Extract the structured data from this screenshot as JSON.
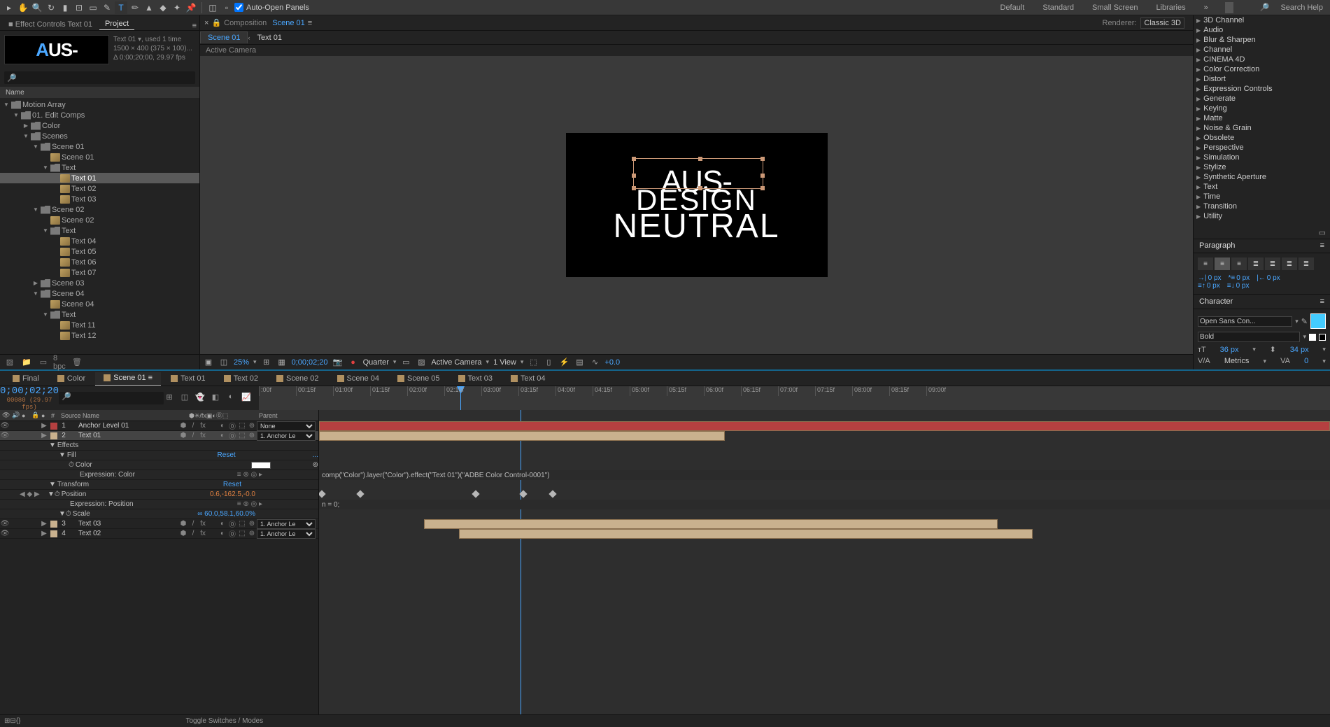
{
  "toolbar": {
    "autoOpen": "Auto-Open Panels",
    "workspaces": [
      "Default",
      "Standard",
      "Small Screen",
      "Libraries"
    ],
    "searchPlaceholder": "Search Help"
  },
  "project": {
    "tabEffect": "Effect Controls Text 01",
    "tabProject": "Project",
    "thumbName": "Text 01 ▾",
    "meta1": ", used 1 time",
    "meta2": "1500 × 400 (375 × 100)...",
    "meta3": "Δ 0;00;20;00, 29.97 fps",
    "headerName": "Name",
    "tree": [
      {
        "d": 0,
        "t": "f",
        "open": true,
        "n": "Motion Array"
      },
      {
        "d": 1,
        "t": "f",
        "open": true,
        "n": "01. Edit Comps"
      },
      {
        "d": 2,
        "t": "f",
        "open": false,
        "n": "Color"
      },
      {
        "d": 2,
        "t": "f",
        "open": true,
        "n": "Scenes"
      },
      {
        "d": 3,
        "t": "f",
        "open": true,
        "n": "Scene 01"
      },
      {
        "d": 4,
        "t": "c",
        "n": "Scene 01"
      },
      {
        "d": 4,
        "t": "f",
        "open": true,
        "n": "Text"
      },
      {
        "d": 5,
        "t": "c",
        "n": "Text 01",
        "sel": true
      },
      {
        "d": 5,
        "t": "c",
        "n": "Text 02"
      },
      {
        "d": 5,
        "t": "c",
        "n": "Text 03"
      },
      {
        "d": 3,
        "t": "f",
        "open": true,
        "n": "Scene 02"
      },
      {
        "d": 4,
        "t": "c",
        "n": "Scene 02"
      },
      {
        "d": 4,
        "t": "f",
        "open": true,
        "n": "Text"
      },
      {
        "d": 5,
        "t": "c",
        "n": "Text 04"
      },
      {
        "d": 5,
        "t": "c",
        "n": "Text 05"
      },
      {
        "d": 5,
        "t": "c",
        "n": "Text 06"
      },
      {
        "d": 5,
        "t": "c",
        "n": "Text 07"
      },
      {
        "d": 3,
        "t": "f",
        "open": false,
        "n": "Scene 03"
      },
      {
        "d": 3,
        "t": "f",
        "open": true,
        "n": "Scene 04"
      },
      {
        "d": 4,
        "t": "c",
        "n": "Scene 04"
      },
      {
        "d": 4,
        "t": "f",
        "open": true,
        "n": "Text"
      },
      {
        "d": 5,
        "t": "c",
        "n": "Text 11"
      },
      {
        "d": 5,
        "t": "c",
        "n": "Text 12"
      }
    ],
    "bpc": "8 bpc"
  },
  "comp": {
    "label": "Composition",
    "name": "Scene 01",
    "subActive": "Scene 01",
    "subOther": "Text 01",
    "rendererLabel": "Renderer:",
    "renderer": "Classic 3D",
    "activeCamera": "Active Camera",
    "line1": "AUS-",
    "line2": "DESIGN",
    "line3": "NEUTRAL",
    "zoom": "25%",
    "timecode": "0;00;02;20",
    "quality": "Quarter",
    "view": "Active Camera",
    "nviews": "1 View",
    "exposure": "+0.0"
  },
  "effects": {
    "cats": [
      "3D Channel",
      "Audio",
      "Blur & Sharpen",
      "Channel",
      "CINEMA 4D",
      "Color Correction",
      "Distort",
      "Expression Controls",
      "Generate",
      "Keying",
      "Matte",
      "Noise & Grain",
      "Obsolete",
      "Perspective",
      "Simulation",
      "Stylize",
      "Synthetic Aperture",
      "Text",
      "Time",
      "Transition",
      "Utility"
    ]
  },
  "paragraph": {
    "title": "Paragraph",
    "px": "0 px"
  },
  "character": {
    "title": "Character",
    "font": "Open Sans Con...",
    "weight": "Bold",
    "size": "36 px",
    "leading": "34 px",
    "kerning": "Metrics",
    "tracking": "0"
  },
  "timeline": {
    "tabs": [
      "Final",
      "Color",
      "Scene 01",
      "Text 01",
      "Text 02",
      "Scene 02",
      "Scene 04",
      "Scene 05",
      "Text 03",
      "Text 04"
    ],
    "activeTab": 2,
    "timecode": "0;00;02;20",
    "frameinfo": "00080 (29.97 fps)",
    "ticks": [
      ":00f",
      "00:15f",
      "01:00f",
      "01:15f",
      "02:00f",
      "02:15f",
      "03:00f",
      "03:15f",
      "04:00f",
      "04:15f",
      "05:00f",
      "05:15f",
      "06:00f",
      "06:15f",
      "07:00f",
      "07:15f",
      "08:00f",
      "08:15f",
      "09:00f"
    ],
    "cols": {
      "source": "Source Name",
      "parent": "Parent"
    },
    "layers": [
      {
        "num": "1",
        "color": "#b54040",
        "name": "Anchor Level 01",
        "parent": "None"
      },
      {
        "num": "2",
        "color": "#c9b18e",
        "name": "Text 01",
        "parent": "1. Anchor Le",
        "sel": true
      },
      {
        "prop": true,
        "d": 1,
        "name": "Effects"
      },
      {
        "prop": true,
        "d": 2,
        "name": "Fill",
        "extra": "Reset",
        "blue": true,
        "dots": "..."
      },
      {
        "prop": true,
        "d": 3,
        "name": "Color",
        "swatch": "#ffffff"
      },
      {
        "prop": true,
        "d": 4,
        "name": "Expression: Color"
      },
      {
        "prop": true,
        "d": 1,
        "name": "Transform",
        "extra": "Reset",
        "blue": true
      },
      {
        "prop": true,
        "d": 2,
        "name": "Position",
        "kfnav": true,
        "vals": "0.6,-162.5,-0.0",
        "orange": true
      },
      {
        "prop": true,
        "d": 3,
        "name": "Expression: Position"
      },
      {
        "prop": true,
        "d": 2,
        "name": "Scale",
        "vals": "60.0,58.1,60.0%",
        "link": true
      },
      {
        "num": "3",
        "color": "#c9b18e",
        "name": "Text 03",
        "parent": "1. Anchor Le"
      },
      {
        "num": "4",
        "color": "#c9b18e",
        "name": "Text 02",
        "parent": "1. Anchor Le"
      }
    ],
    "expr1": "comp(\"Color\").layer(\"Color\").effect(\"Text 01\")(\"ADBE Color Control-0001\")",
    "expr2": "n = 0;",
    "footToggle": "Toggle Switches / Modes"
  }
}
